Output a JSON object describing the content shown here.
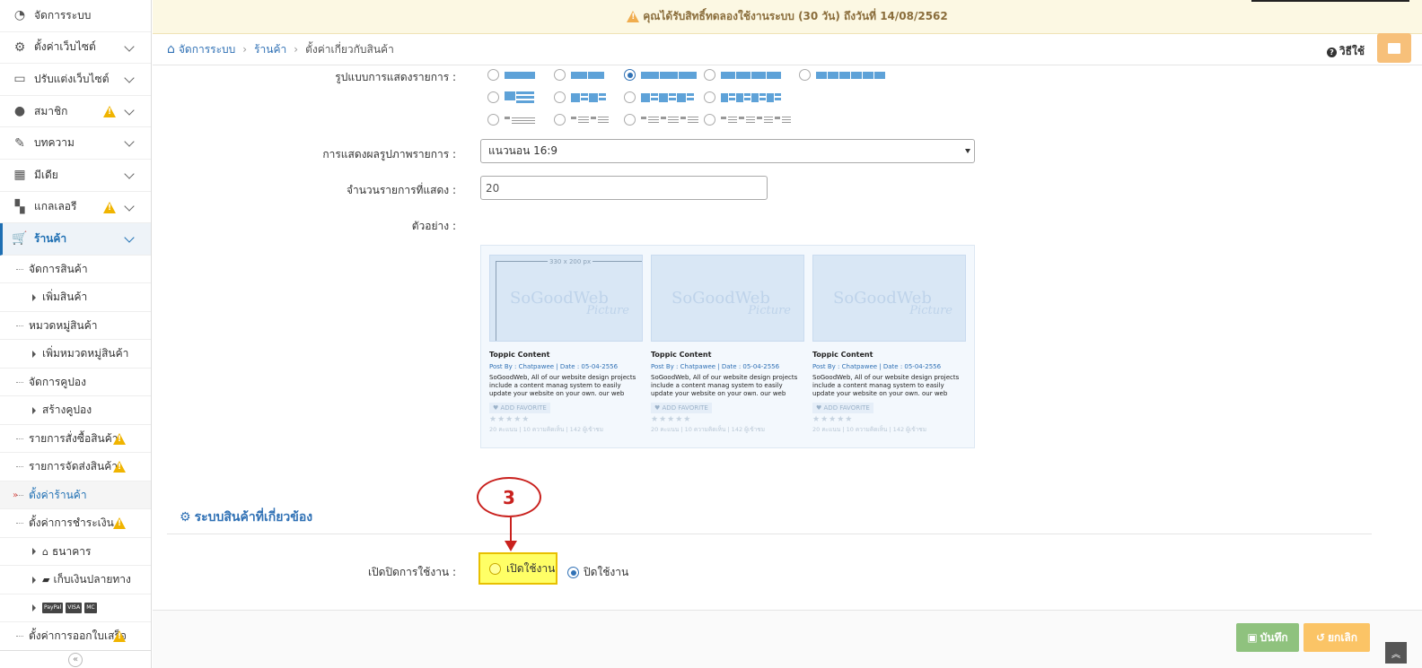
{
  "notice": {
    "text": "คุณได้รับสิทธิ์ทดลองใช้งานระบบ (30 วัน) ถึงวันที่ 14/08/2562"
  },
  "breadcrumb": {
    "home": "จัดการระบบ",
    "shop": "ร้านค้า",
    "current": "ตั้งค่าเกี่ยวกับสินค้า"
  },
  "help": {
    "label": "วิธีใช้"
  },
  "sidebar": {
    "items": [
      {
        "label": "จัดการระบบ",
        "icon": "dashboard-icon"
      },
      {
        "label": "ตั้งค่าเว็บไซต์",
        "icon": "gear-icon"
      },
      {
        "label": "ปรับแต่งเว็บไซต์",
        "icon": "monitor-icon"
      },
      {
        "label": "สมาชิก",
        "icon": "user-icon"
      },
      {
        "label": "บทความ",
        "icon": "edit-icon"
      },
      {
        "label": "มีเดีย",
        "icon": "film-icon"
      },
      {
        "label": "แกลเลอรี",
        "icon": "grid-icon"
      },
      {
        "label": "ร้านค้า",
        "icon": "cart-icon"
      }
    ],
    "subitems": [
      {
        "label": "จัดการสินค้า"
      },
      {
        "label": "เพิ่มสินค้า"
      },
      {
        "label": "หมวดหมู่สินค้า"
      },
      {
        "label": "เพิ่มหมวดหมู่สินค้า"
      },
      {
        "label": "จัดการคูปอง"
      },
      {
        "label": "สร้างคูปอง"
      },
      {
        "label": "รายการสั่งซื้อสินค้า"
      },
      {
        "label": "รายการจัดส่งสินค้า"
      },
      {
        "label": "ตั้งค่าร้านค้า"
      },
      {
        "label": "ตั้งค่าการชำระเงิน"
      },
      {
        "label": "ธนาคาร"
      },
      {
        "label": "เก็บเงินปลายทาง"
      },
      {
        "label": "ตั้งค่าการออกใบเสร็จ"
      }
    ],
    "pay_logos": [
      "PayPal",
      "VISA",
      "MC"
    ]
  },
  "form": {
    "layout_label": "รูปแบบการแสดงรายการ :",
    "image_display_label": "การแสดงผลรูปภาพรายการ :",
    "image_display_value": "แนวนอน 16:9",
    "count_label": "จำนวนรายการที่แสดง :",
    "count_value": "20",
    "example_label": "ตัวอย่าง :"
  },
  "preview": {
    "cards": [
      {
        "dim": "330 x 200 px",
        "watermark": "SoGoodWeb",
        "watermark2": "Picture",
        "title": "Toppic Content",
        "meta": "Post By : Chatpawee  |  Date : 05-04-2556",
        "desc": "SoGoodWeb, All of our website design projects include a content manag system to easily update your website on your own. our web designers can",
        "fav": "ADD FAVORITE",
        "stars": "★★★★★",
        "foot": "20 คะแนน | 10 ความคิดเห็น | 142 ผู้เข้าชม"
      },
      {
        "dim": "",
        "watermark": "SoGoodWeb",
        "watermark2": "Picture",
        "title": "Toppic Content",
        "meta": "Post By : Chatpawee  |  Date : 05-04-2556",
        "desc": "SoGoodWeb, All of our website design projects include a content manag system to easily update your website on your own. our web designers can",
        "fav": "ADD FAVORITE",
        "stars": "★★★★★",
        "foot": "20 คะแนน | 10 ความคิดเห็น | 142 ผู้เข้าชม"
      },
      {
        "dim": "",
        "watermark": "SoGoodWeb",
        "watermark2": "Picture",
        "title": "Toppic Content",
        "meta": "Post By : Chatpawee  |  Date : 05-04-2556",
        "desc": "SoGoodWeb, All of our website design projects include a content manag system to easily update your website on your own. our web designers can",
        "fav": "ADD FAVORITE",
        "stars": "★★★★★",
        "foot": "20 คะแนน | 10 ความคิดเห็น | 142 ผู้เข้าชม"
      }
    ]
  },
  "section": {
    "title": "ระบบสินค้าที่เกี่ยวข้อง"
  },
  "toggle": {
    "label": "เปิดปิดการใช้งาน :",
    "on": "เปิดใช้งาน",
    "off": "ปิดใช้งาน"
  },
  "callout": {
    "number": "3"
  },
  "buttons": {
    "save": "บันทึก",
    "cancel": "ยกเลิก"
  },
  "colors": {
    "accent": "#3071b5",
    "warn": "#f0b400",
    "save": "#8fc27e",
    "cancel": "#fbc466",
    "callout": "#c9211e"
  }
}
